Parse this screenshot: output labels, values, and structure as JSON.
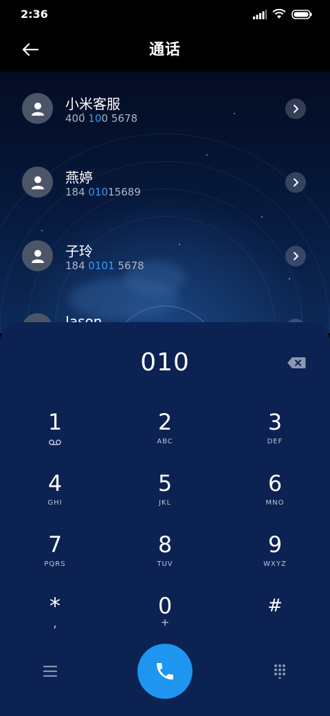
{
  "status": {
    "time": "2:36"
  },
  "header": {
    "title": "通话"
  },
  "contacts": [
    {
      "name": "小米客服",
      "number_parts": [
        "400",
        " ",
        "10",
        "0 5678"
      ]
    },
    {
      "name": "燕婷",
      "number_parts": [
        "184 ",
        "",
        "010",
        "15689"
      ]
    },
    {
      "name": "子玲",
      "number_parts": [
        "184 ",
        "",
        "0101",
        " 5678"
      ]
    },
    {
      "name": "Jason"
    }
  ],
  "dialer": {
    "input": "010",
    "keys": [
      {
        "digit": "1",
        "letters": ""
      },
      {
        "digit": "2",
        "letters": "ABC"
      },
      {
        "digit": "3",
        "letters": "DEF"
      },
      {
        "digit": "4",
        "letters": "GHI"
      },
      {
        "digit": "5",
        "letters": "JKL"
      },
      {
        "digit": "6",
        "letters": "MNO"
      },
      {
        "digit": "7",
        "letters": "PQRS"
      },
      {
        "digit": "8",
        "letters": "TUV"
      },
      {
        "digit": "9",
        "letters": "WXYZ"
      },
      {
        "digit": "*",
        "letters": ","
      },
      {
        "digit": "0",
        "letters": "+"
      },
      {
        "digit": "#",
        "letters": ""
      }
    ]
  },
  "icons": {
    "back": "arrow-left-icon",
    "contact": "person-icon",
    "chevron": "chevron-right-icon",
    "backspace": "backspace-icon",
    "voicemail": "voicemail-icon",
    "menu": "menu-icon",
    "call": "phone-icon",
    "keypad": "keypad-icon"
  },
  "colors": {
    "accent": "#1e96f0",
    "highlight": "#3a9bf0",
    "dialpad_bg": "#0b2253"
  }
}
